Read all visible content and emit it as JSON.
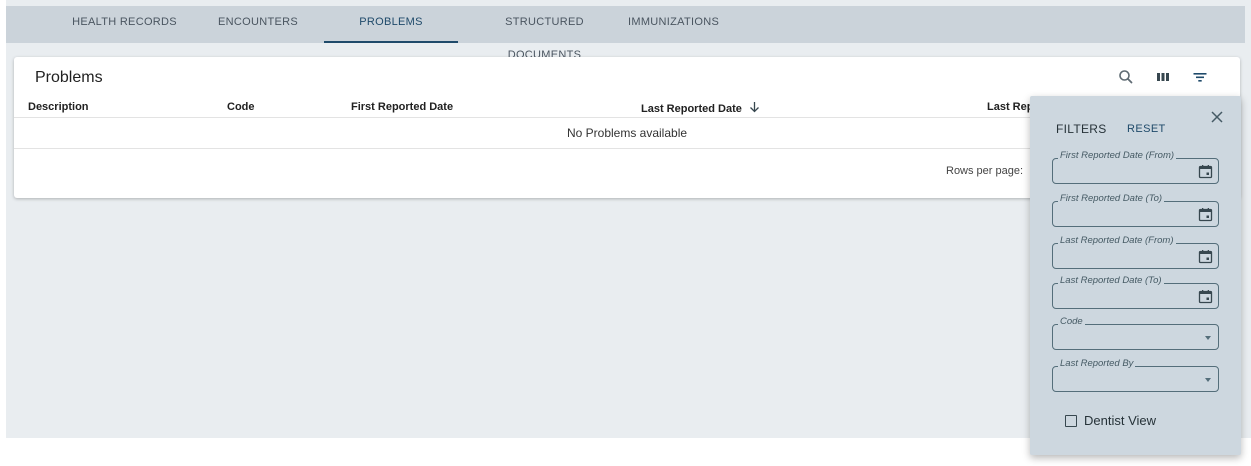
{
  "tabs": [
    {
      "label": "HEALTH RECORDS",
      "active": false
    },
    {
      "label": "ENCOUNTERS",
      "active": false
    },
    {
      "label": "PROBLEMS",
      "active": true
    },
    {
      "label": "STRUCTURED DOCUMENTS",
      "active": false
    },
    {
      "label": "IMMUNIZATIONS",
      "active": false
    }
  ],
  "problems": {
    "title": "Problems",
    "toolbar": {
      "icons": [
        "search-icon",
        "view-columns-icon",
        "filter-icon"
      ]
    },
    "columns": [
      "Description",
      "Code",
      "First Reported Date",
      "Last Reported Date",
      "Last Rep"
    ],
    "sorted_column": "Last Reported Date",
    "empty_message": "No Problems available",
    "rows_per_page_label": "Rows per page:"
  },
  "filters": {
    "title": "FILTERS",
    "reset_label": "RESET",
    "fields": [
      {
        "label": "First Reported Date (From)",
        "type": "date",
        "value": ""
      },
      {
        "label": "First Reported Date (To)",
        "type": "date",
        "value": ""
      },
      {
        "label": "Last Reported Date (From)",
        "type": "date",
        "value": ""
      },
      {
        "label": "Last Reported Date (To)",
        "type": "date",
        "value": ""
      },
      {
        "label": "Code",
        "type": "select",
        "value": ""
      },
      {
        "label": "Last Reported By",
        "type": "select",
        "value": ""
      }
    ],
    "checkbox": {
      "label": "Dentist View",
      "checked": false
    }
  },
  "colors": {
    "accent": "#1f4a6a",
    "tabbar": "#cbd3da",
    "background": "#e9edf0",
    "panel": "#cdd7df"
  }
}
